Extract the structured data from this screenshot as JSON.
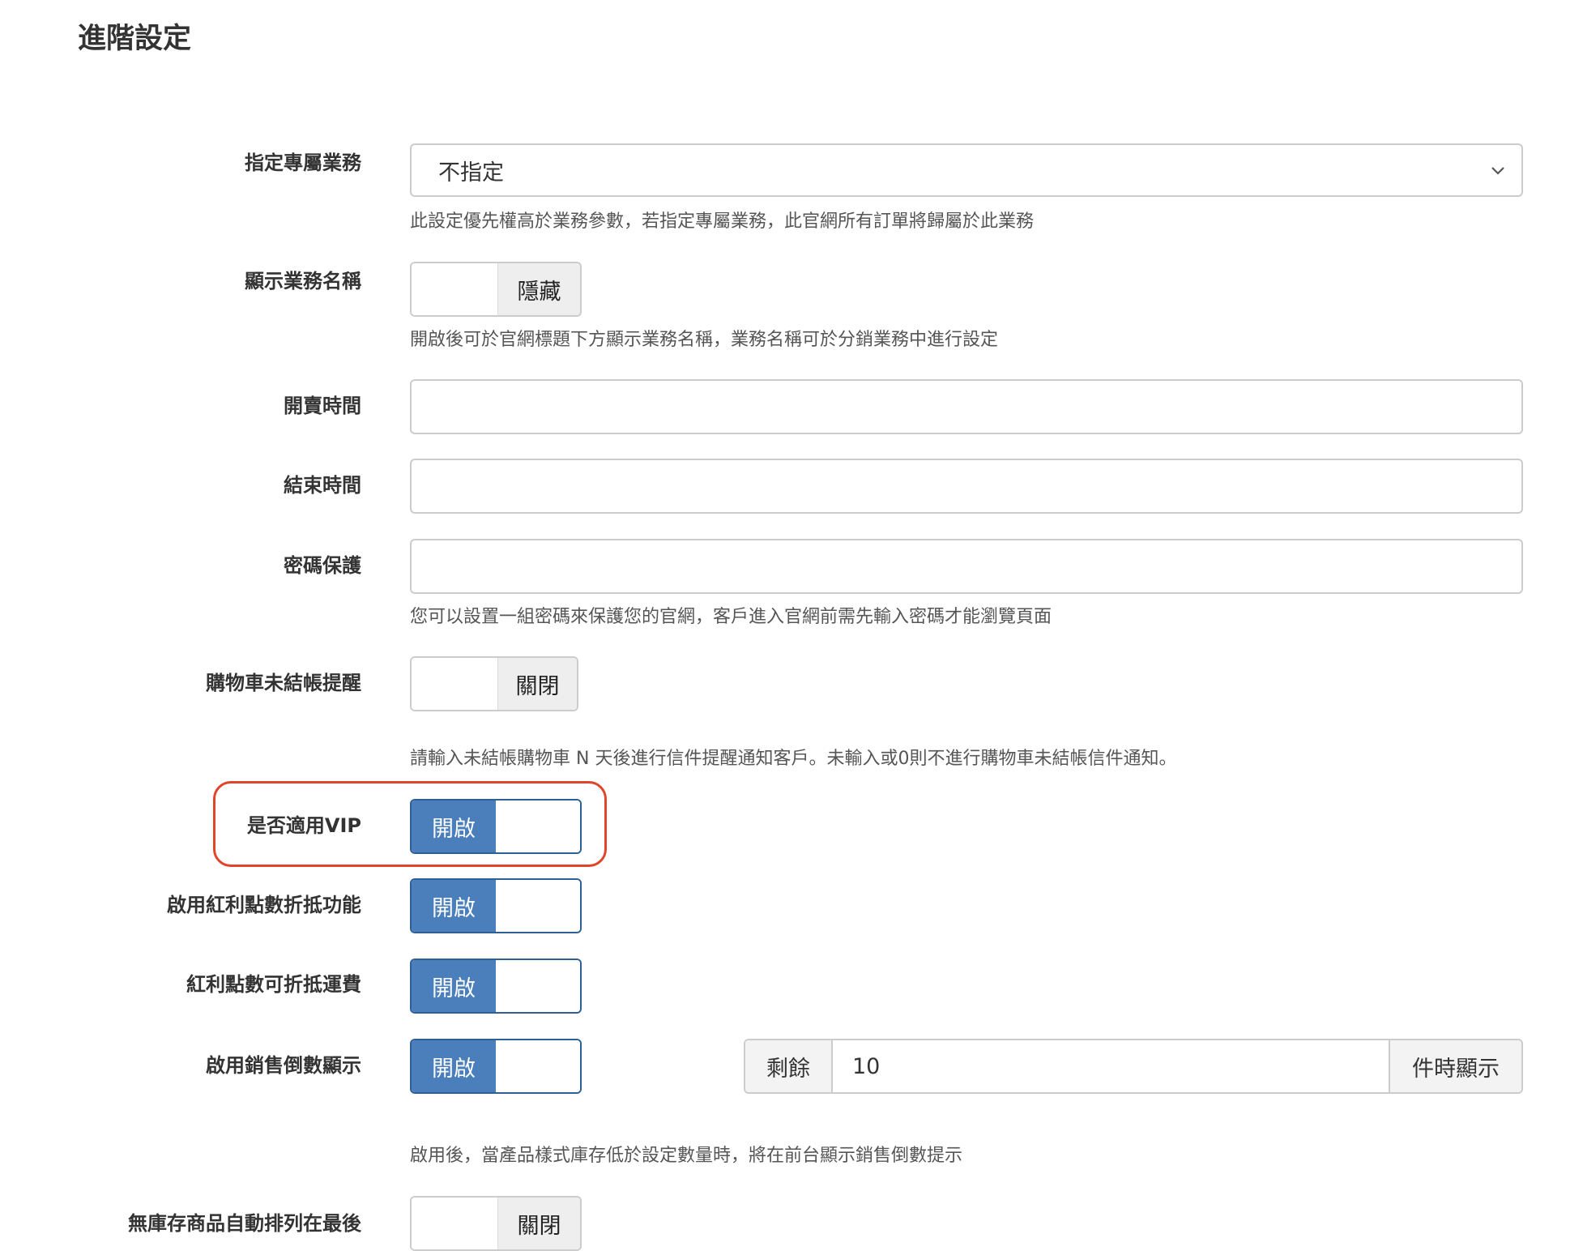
{
  "page": {
    "title": "進階設定"
  },
  "colors": {
    "toggle_on": "#4a7fbb",
    "toggle_on_border": "#2e5f96",
    "highlight": "#e0452a"
  },
  "fields": {
    "sales_rep": {
      "label": "指定專屬業務",
      "selected": "不指定",
      "help": "此設定優先權高於業務參數，若指定專屬業務，此官網所有訂單將歸屬於此業務"
    },
    "show_sales_name": {
      "label": "顯示業務名稱",
      "state": "隱藏",
      "help": "開啟後可於官網標題下方顯示業務名稱，業務名稱可於分銷業務中進行設定"
    },
    "sale_start": {
      "label": "開賣時間",
      "value": ""
    },
    "sale_end": {
      "label": "結束時間",
      "value": ""
    },
    "password": {
      "label": "密碼保護",
      "value": "",
      "help": "您可以設置一組密碼來保護您的官網，客戶進入官網前需先輸入密碼才能瀏覽頁面"
    },
    "cart_reminder": {
      "label": "購物車未結帳提醒",
      "state": "關閉",
      "help": "請輸入未結帳購物車 N 天後進行信件提醒通知客戶。未輸入或0則不進行購物車未結帳信件通知。"
    },
    "vip": {
      "label": "是否適用VIP",
      "state": "開啟"
    },
    "bonus_points": {
      "label": "啟用紅利點數折抵功能",
      "state": "開啟"
    },
    "bonus_shipping": {
      "label": "紅利點數可折抵運費",
      "state": "開啟"
    },
    "sales_countdown": {
      "label": "啟用銷售倒數顯示",
      "state": "開啟",
      "prefix": "剩餘",
      "value": "10",
      "suffix": "件時顯示",
      "help": "啟用後，當產品樣式庫存低於設定數量時，將在前台顯示銷售倒數提示"
    },
    "out_of_stock_last": {
      "label": "無庫存商品自動排列在最後",
      "state": "關閉"
    }
  }
}
